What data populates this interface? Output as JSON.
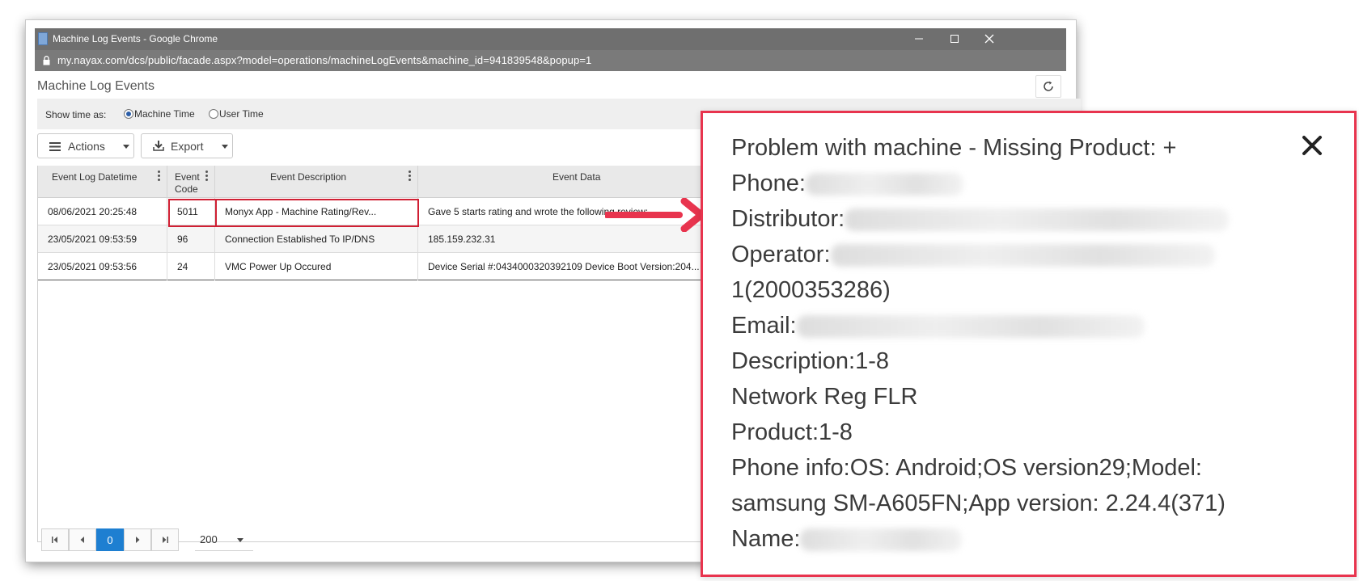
{
  "browser": {
    "window_title": "Machine Log Events - Google Chrome",
    "url": "my.nayax.com/dcs/public/facade.aspx?model=operations/machineLogEvents&machine_id=941839548&popup=1"
  },
  "page": {
    "title": "Machine Log Events",
    "show_time_label": "Show time as:",
    "time_options": [
      {
        "label": "Machine Time",
        "selected": true
      },
      {
        "label": "User Time",
        "selected": false
      }
    ],
    "toolbar": {
      "actions_label": "Actions",
      "export_label": "Export"
    }
  },
  "table": {
    "columns": [
      {
        "label": "Event Log Datetime"
      },
      {
        "label": "Event Code"
      },
      {
        "label": "Event Description"
      },
      {
        "label": "Event Data"
      }
    ],
    "rows": [
      {
        "datetime": "08/06/2021 20:25:48",
        "code": "5011",
        "description": "Monyx App - Machine Rating/Rev...",
        "data": "Gave 5 starts rating and wrote the following review:"
      },
      {
        "datetime": "23/05/2021 09:53:59",
        "code": "96",
        "description": "Connection Established To IP/DNS",
        "data": "185.159.232.31"
      },
      {
        "datetime": "23/05/2021 09:53:56",
        "code": "24",
        "description": "VMC Power Up Occured",
        "data": "Device Serial #:0434000320392109 Device Boot Version:204..."
      }
    ]
  },
  "pager": {
    "current_page": "0",
    "page_size": "200"
  },
  "popup": {
    "lines": [
      {
        "text": "Problem with machine - Missing Product: +"
      },
      {
        "text": "Phone:",
        "redacted": true
      },
      {
        "text": "Distributor:",
        "redacted": true
      },
      {
        "text": "Operator:",
        "redacted": true
      },
      {
        "text": "1(2000353286)"
      },
      {
        "text": "Email:",
        "redacted": true
      },
      {
        "text": "Description:1-8"
      },
      {
        "text": "Network Reg FLR"
      },
      {
        "text": "Product:1-8"
      },
      {
        "text": "Phone info:OS: Android;OS version29;Model:"
      },
      {
        "text": "samsung SM-A605FN;App version: 2.24.4(371)"
      },
      {
        "text": "Name:",
        "redacted": true
      }
    ]
  },
  "colors": {
    "highlight": "#d01f33",
    "popup_border": "#e8344e",
    "pager_active": "#1e7fd1"
  }
}
